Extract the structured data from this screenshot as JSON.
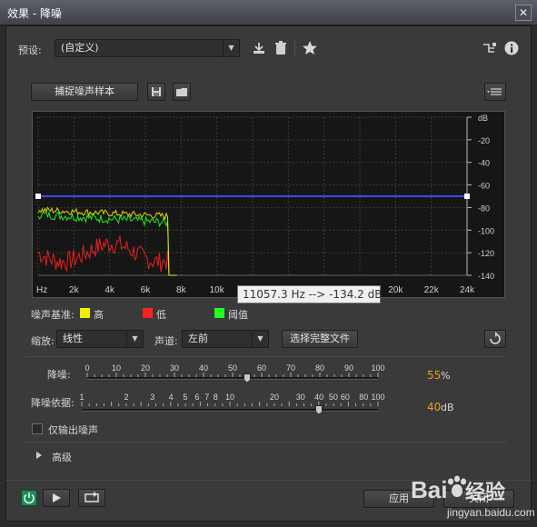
{
  "window": {
    "title": "效果 - 降噪",
    "close_label": "✕"
  },
  "presets": {
    "label": "预设:",
    "value": "(自定义)"
  },
  "capture": {
    "label": "捕捉噪声样本"
  },
  "graph": {
    "y_unit": "dB",
    "y_ticks": [
      "-20",
      "-40",
      "-60",
      "-80",
      "-100",
      "-120",
      "-140"
    ],
    "x_ticks": [
      "Hz",
      "2k",
      "4k",
      "6k",
      "8k",
      "10k",
      "12k",
      "14k",
      "16k",
      "18k",
      "20k",
      "22k",
      "24k"
    ],
    "threshold_db": -70,
    "tooltip": "11057.3 Hz --> -134.2 dB"
  },
  "legend": {
    "label": "噪声基准:",
    "items": [
      {
        "name": "高",
        "color": "#f0f000"
      },
      {
        "name": "低",
        "color": "#ff2020"
      },
      {
        "name": "阈值",
        "color": "#20ff20"
      }
    ]
  },
  "controls": {
    "scale_label": "缩放:",
    "scale_value": "线性",
    "channel_label": "声道:",
    "channel_value": "左前",
    "select_file": "选择完整文件"
  },
  "reduction": {
    "label": "降噪:",
    "ticks": [
      "0",
      "10",
      "20",
      "30",
      "40",
      "50",
      "60",
      "70",
      "80",
      "90",
      "100"
    ],
    "value_percent": 55,
    "value": "55",
    "unit": "%"
  },
  "reduce_by": {
    "label": "降噪依据:",
    "ticks": [
      "1",
      "2",
      "3",
      "4",
      "5",
      "6",
      "7",
      "8",
      "10",
      "20",
      "30",
      "40",
      "50",
      "60",
      "80",
      "100"
    ],
    "value_db": 40,
    "value": "40",
    "unit": "dB"
  },
  "output_noise": {
    "label": "仅输出噪声"
  },
  "advanced": {
    "label": "高级"
  },
  "footer": {
    "apply_label": "应用",
    "close_label": "关闭"
  },
  "colors": {
    "accent": "#e8a01c",
    "threshold_line": "#3a4df0",
    "power_on": "#1f8a5a"
  }
}
